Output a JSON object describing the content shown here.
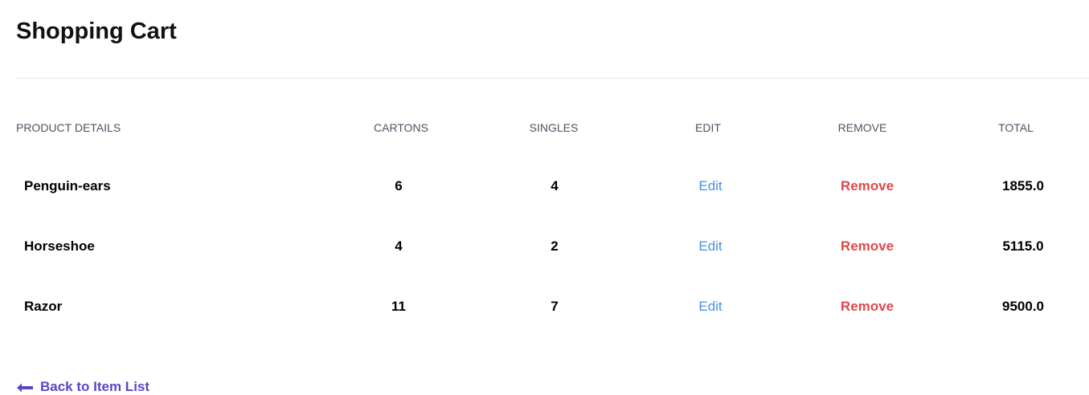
{
  "page": {
    "title": "Shopping Cart"
  },
  "table": {
    "headers": {
      "product": "Product Details",
      "cartons": "Cartons",
      "singles": "Singles",
      "edit": "Edit",
      "remove": "Remove",
      "total": "Total"
    },
    "rows": [
      {
        "product": "Penguin-ears",
        "cartons": "6",
        "singles": "4",
        "edit": "Edit",
        "remove": "Remove",
        "total": "1855.0"
      },
      {
        "product": "Horseshoe",
        "cartons": "4",
        "singles": "2",
        "edit": "Edit",
        "remove": "Remove",
        "total": "5115.0"
      },
      {
        "product": "Razor",
        "cartons": "11",
        "singles": "7",
        "edit": "Edit",
        "remove": "Remove",
        "total": "9500.0"
      }
    ]
  },
  "footer": {
    "back_label": "Back to Item List",
    "back_icon": "arrow-left-icon"
  },
  "colors": {
    "edit": "#4a8fe2",
    "remove": "#e0474f",
    "back_link": "#5b46c8",
    "header_text": "#4b5563",
    "divider": "#e6e7ea"
  }
}
